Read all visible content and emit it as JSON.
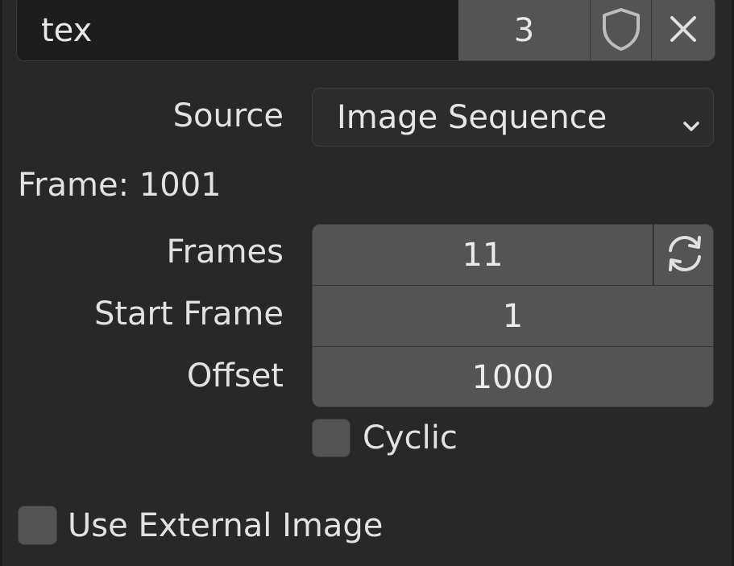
{
  "id_block": {
    "name": "tex",
    "users": "3",
    "fake_user_icon": "shield-icon",
    "unlink_icon": "close-icon"
  },
  "source": {
    "label": "Source",
    "value": "Image Sequence",
    "icon": "chevron-down-icon"
  },
  "frame_info": "Frame: 1001",
  "sequence": {
    "frames_label": "Frames",
    "frames_value": "11",
    "refresh_icon": "refresh-icon",
    "start_frame_label": "Start Frame",
    "start_frame_value": "1",
    "offset_label": "Offset",
    "offset_value": "1000",
    "cyclic_label": "Cyclic",
    "cyclic_checked": false
  },
  "use_external_image": {
    "label": "Use External Image",
    "checked": false
  },
  "colors": {
    "panel_bg": "#282828",
    "field_bg": "#545454",
    "text_field_bg": "#1d1d1d",
    "text": "#e6e6e6"
  }
}
